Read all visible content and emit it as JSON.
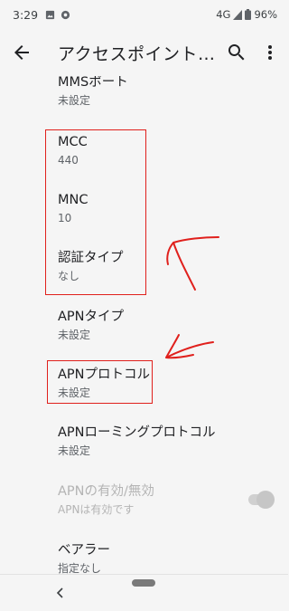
{
  "status_bar": {
    "time": "3:29",
    "network": "4G",
    "battery": "96%",
    "icons": [
      "image-icon",
      "chrome-icon",
      "signal-icon",
      "battery-icon"
    ]
  },
  "app_bar": {
    "title": "アクセスポイント…",
    "icons": [
      "back-arrow-icon",
      "search-icon",
      "more-vert-icon"
    ]
  },
  "preferences": [
    {
      "title": "MMSポート",
      "summary": "未設定"
    },
    {
      "title": "MCC",
      "summary": "440"
    },
    {
      "title": "MNC",
      "summary": "10"
    },
    {
      "title": "認証タイプ",
      "summary": "なし"
    },
    {
      "title": "APNタイプ",
      "summary": "未設定"
    },
    {
      "title": "APNプロトコル",
      "summary": "未設定"
    },
    {
      "title": "APNローミングプロトコル",
      "summary": "未設定"
    },
    {
      "title": "APNの有効/無効",
      "summary": "APNは有効です",
      "enabled": false,
      "toggle_on": true
    },
    {
      "title": "ベアラー",
      "summary": "指定なし"
    }
  ],
  "annotations": {
    "color": "#e0201c"
  },
  "nav_bar": {
    "icons": [
      "nav-back-icon",
      "home-pill-icon"
    ]
  }
}
